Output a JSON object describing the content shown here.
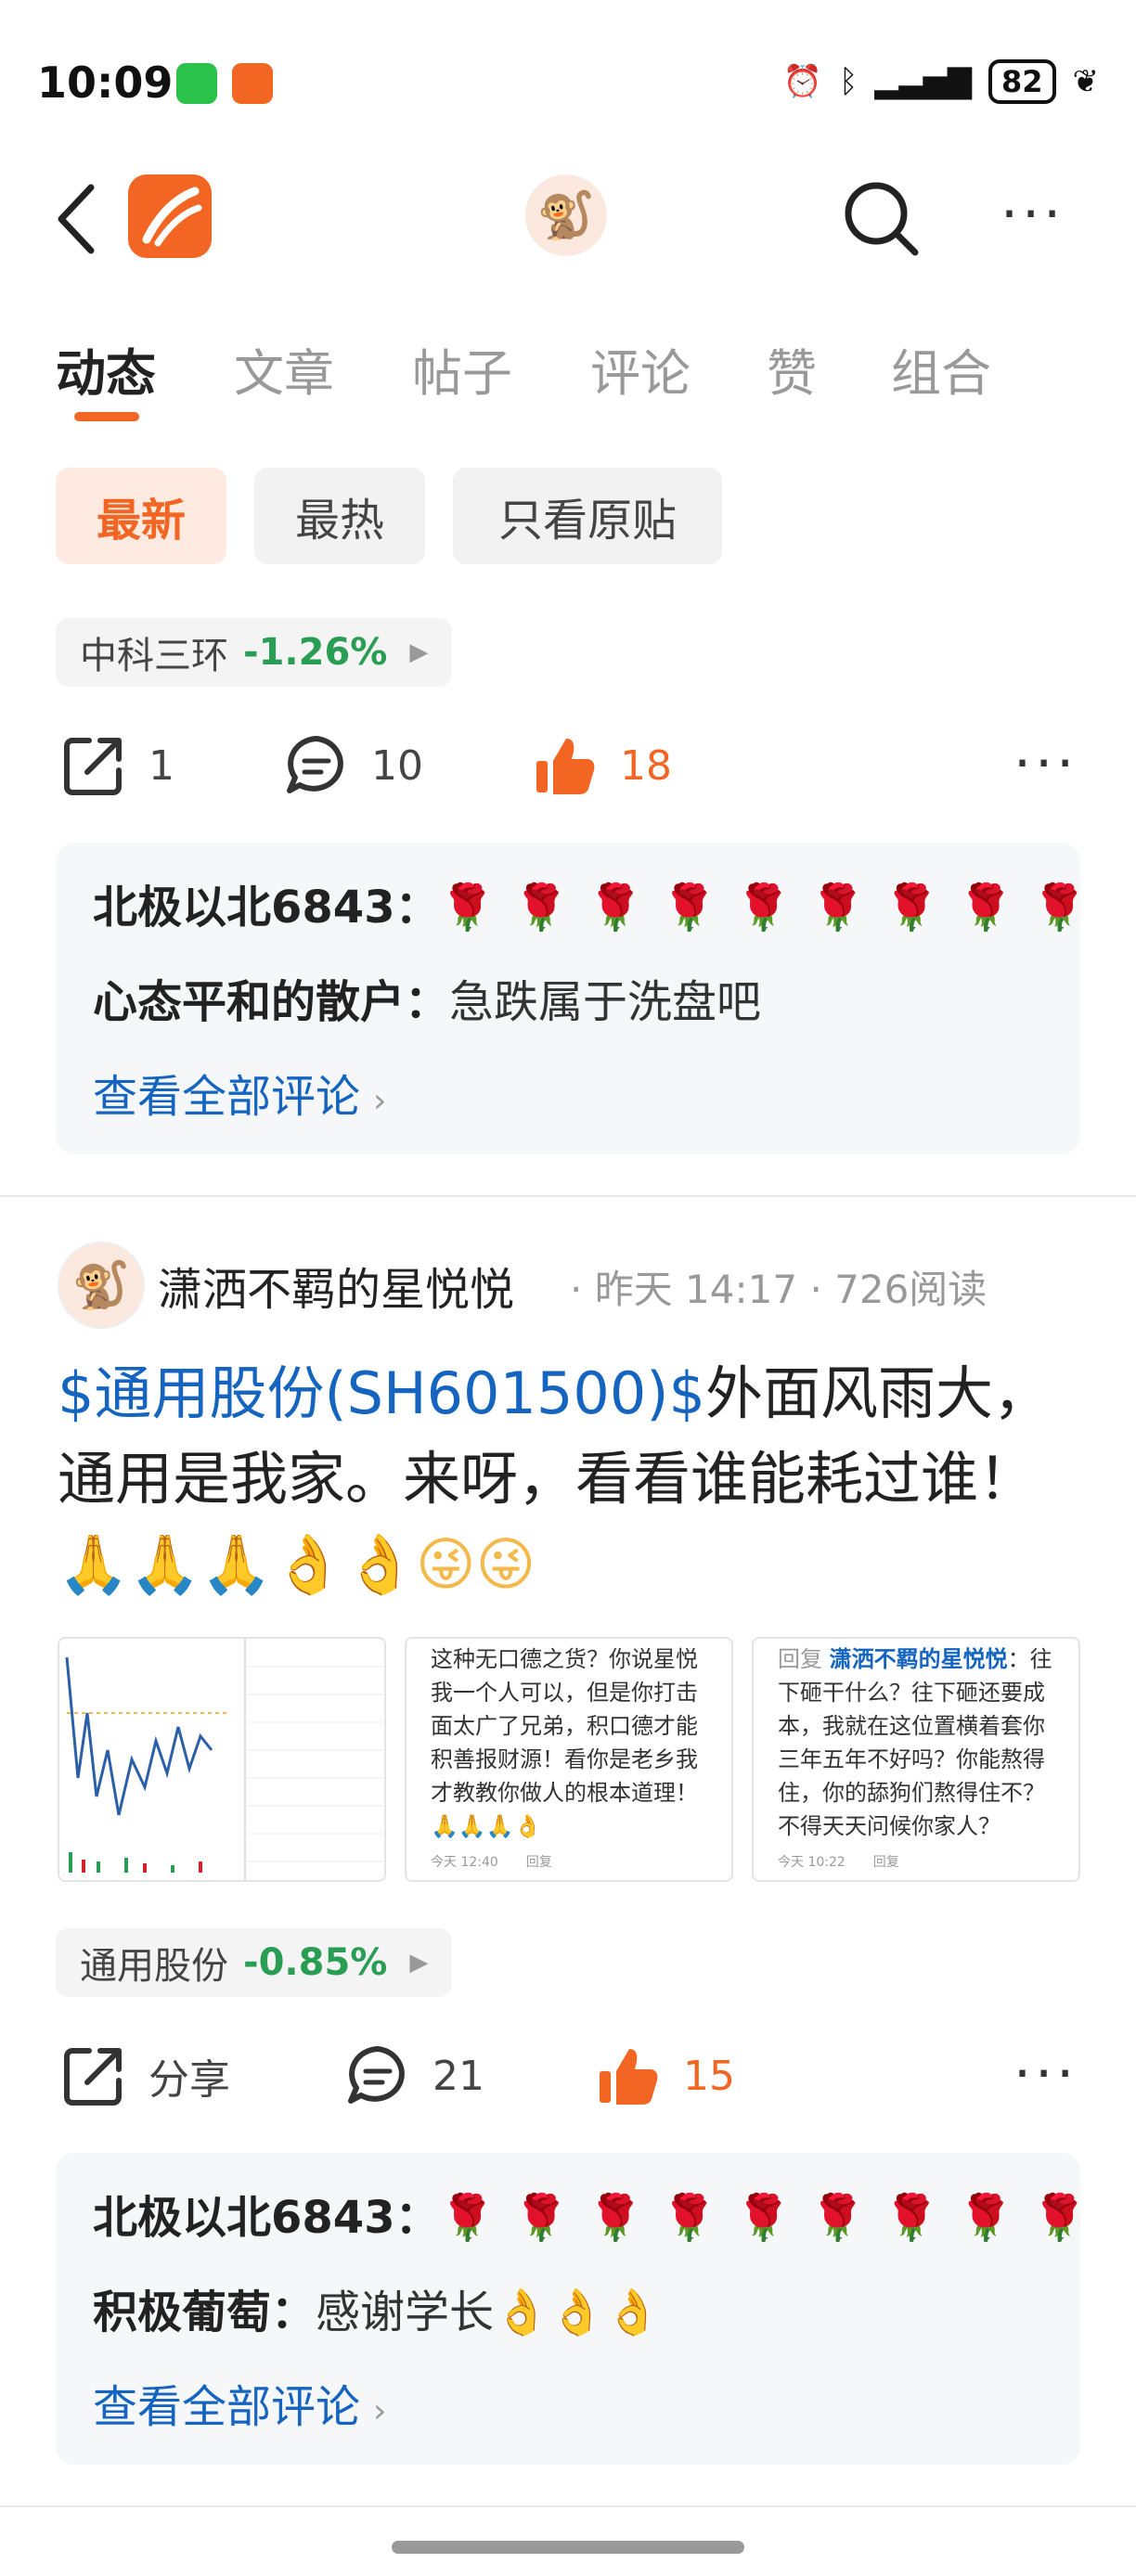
{
  "status_bar": {
    "time": "10:09",
    "battery": "82",
    "icons": [
      "wechat-icon",
      "xueqiu-icon",
      "alarm-icon",
      "bluetooth-icon",
      "signal-icon",
      "leaf-icon"
    ]
  },
  "nav": {
    "icons": [
      "back-icon",
      "app-logo",
      "avatar",
      "search-icon",
      "more-icon"
    ]
  },
  "tabs": [
    "动态",
    "文章",
    "帖子",
    "评论",
    "赞",
    "组合"
  ],
  "filters": [
    "最新",
    "最热",
    "只看原贴"
  ],
  "accent": "#f26522",
  "post1": {
    "stock_tag": {
      "name": "中科三环",
      "pct": "-1.26%"
    },
    "actions": {
      "share": "1",
      "comments": "10",
      "likes": "18"
    },
    "comments": [
      {
        "user": "北极以北6843：",
        "text": "🌹🌹🌹🌹🌹🌹🌹🌹🌹"
      },
      {
        "user": "心态平和的散户：",
        "text": "急跌属于洗盘吧"
      }
    ],
    "view_all": "查看全部评论"
  },
  "post2": {
    "author": "潇洒不羁的星悦悦",
    "meta": "· 昨天 14:17 · 726阅读",
    "link": "$通用股份(SH601500)$",
    "text": "外面风雨大，通用是我家。来呀，看看谁能耗过谁！",
    "emojis": "🙏🙏🙏👌👌😜😜",
    "thumb2": {
      "text": "这种无口德之货？你说星悦我一个人可以，但是你打击面太广了兄弟，积口德才能积善报财源！看你是老乡我才教教你做人的根本道理！🙏🙏🙏👌",
      "time": "今天 12:40",
      "reply": "回复"
    },
    "thumb3": {
      "prefix": "回复",
      "mention": "潇洒不羁的星悦悦",
      "text": "：往下砸干什么？往下砸还要成本，我就在这位置横着套你三年五年不好吗？你能熬得住，你的舔狗们熬得住不？不得天天问候你家人？",
      "time": "今天 10:22",
      "reply": "回复"
    },
    "stock_tag": {
      "name": "通用股份",
      "pct": "-0.85%"
    },
    "actions": {
      "share": "分享",
      "comments": "21",
      "likes": "15"
    },
    "comments": [
      {
        "user": "北极以北6843：",
        "text": "🌹🌹🌹🌹🌹🌹🌹🌹🌹"
      },
      {
        "user": "积极葡萄：",
        "text": "感谢学长👌👌👌"
      }
    ],
    "view_all": "查看全部评论"
  }
}
